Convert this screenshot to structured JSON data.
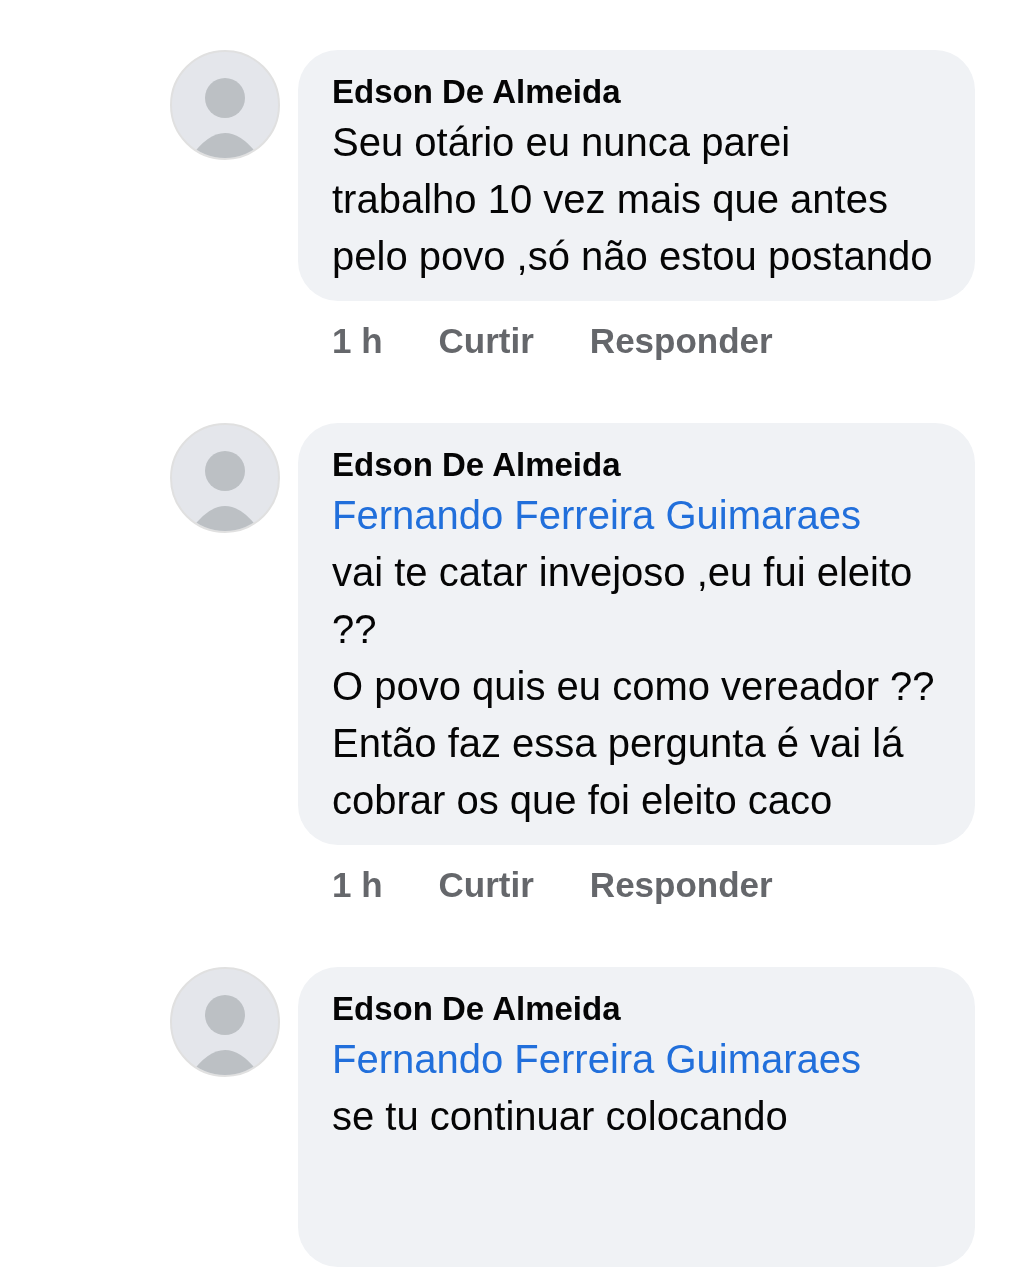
{
  "comments": [
    {
      "author": "Edson De Almeida",
      "text": "Seu otário eu nunca parei trabalho 10 vez mais que antes pelo povo ,só não estou postando",
      "meta": {
        "time": "1 h",
        "like": "Curtir",
        "reply": "Responder"
      }
    },
    {
      "author": "Edson De Almeida",
      "mention": "Fernando Ferreira Guimaraes",
      "text": "vai te catar invejoso ,eu fui eleito ??\nO povo quis eu como vereador ?? Então faz essa pergunta é vai lá cobrar os que foi eleito caco",
      "meta": {
        "time": "1 h",
        "like": "Curtir",
        "reply": "Responder"
      }
    },
    {
      "author": "Edson De Almeida",
      "mention": "Fernando Ferreira Guimaraes",
      "text": "se tu continuar colocando"
    }
  ]
}
